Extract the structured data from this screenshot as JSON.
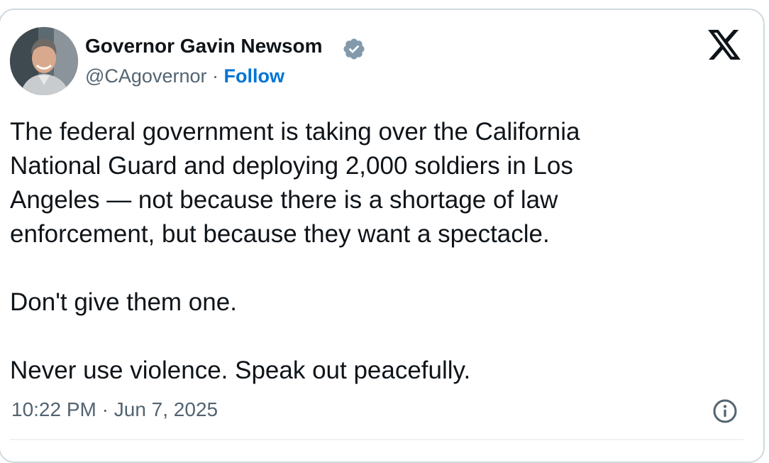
{
  "author": {
    "name": "Governor Gavin Newsom",
    "handle": "@CAgovernor",
    "separator": " · ",
    "follow_label": "Follow",
    "verified_color": "#829aab"
  },
  "icons": {
    "platform": "x-logo-icon",
    "verified": "verified-badge-icon",
    "info": "info-icon"
  },
  "tweet": {
    "text": "The federal government is taking over the California\nNational Guard and deploying 2,000 soldiers in Los\nAngeles — not because there is a shortage of law\nenforcement, but because they want a spectacle.\n\nDon't give them one.\n\nNever use violence. Speak out peacefully.",
    "time": "10:22 PM",
    "date_separator": " · ",
    "date": "Jun 7, 2025"
  },
  "colors": {
    "link": "#0074d4",
    "secondary_text": "#536471",
    "border": "#cfd9de"
  }
}
